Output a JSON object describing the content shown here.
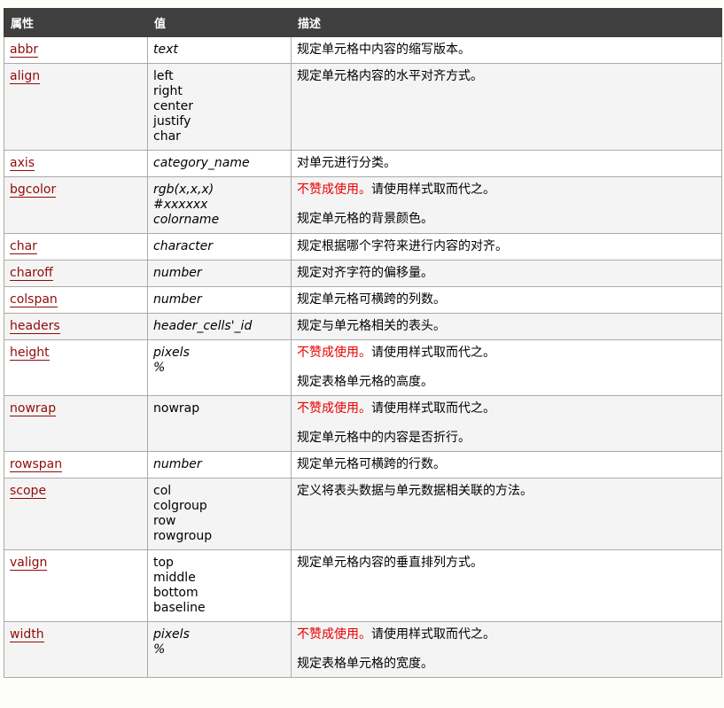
{
  "table": {
    "headers": [
      "属性",
      "值",
      "描述"
    ],
    "deprecated_label": "不赞成使用。",
    "deprecated_hint": "请使用样式取而代之。",
    "colors": {
      "header_bg": "#3f3f3f",
      "link": "#900b09",
      "deprecated": "#e80000",
      "row_alt_bg": "#f4f4f4"
    },
    "rows": [
      {
        "attribute": "abbr",
        "values": [
          {
            "text": "text",
            "italic": true
          }
        ],
        "deprecated": false,
        "description": "规定单元格中内容的缩写版本。"
      },
      {
        "attribute": "align",
        "values": [
          {
            "text": "left",
            "italic": false
          },
          {
            "text": "right",
            "italic": false
          },
          {
            "text": "center",
            "italic": false
          },
          {
            "text": "justify",
            "italic": false
          },
          {
            "text": "char",
            "italic": false
          }
        ],
        "deprecated": false,
        "description": "规定单元格内容的水平对齐方式。"
      },
      {
        "attribute": "axis",
        "values": [
          {
            "text": "category_name",
            "italic": true
          }
        ],
        "deprecated": false,
        "description": "对单元进行分类。"
      },
      {
        "attribute": "bgcolor",
        "values": [
          {
            "text": "rgb(x,x,x)",
            "italic": true
          },
          {
            "text": "#xxxxxx",
            "italic": true
          },
          {
            "text": "colorname",
            "italic": true
          }
        ],
        "deprecated": true,
        "description": "规定单元格的背景颜色。"
      },
      {
        "attribute": "char",
        "values": [
          {
            "text": "character",
            "italic": true
          }
        ],
        "deprecated": false,
        "description": "规定根据哪个字符来进行内容的对齐。"
      },
      {
        "attribute": "charoff",
        "values": [
          {
            "text": "number",
            "italic": true
          }
        ],
        "deprecated": false,
        "description": "规定对齐字符的偏移量。"
      },
      {
        "attribute": "colspan",
        "values": [
          {
            "text": "number",
            "italic": true
          }
        ],
        "deprecated": false,
        "description": "规定单元格可横跨的列数。"
      },
      {
        "attribute": "headers",
        "values": [
          {
            "text": "header_cells'_id",
            "italic": true
          }
        ],
        "deprecated": false,
        "description": "规定与单元格相关的表头。"
      },
      {
        "attribute": "height",
        "values": [
          {
            "text": "pixels",
            "italic": true
          },
          {
            "text": "%",
            "italic": true
          }
        ],
        "deprecated": true,
        "description": "规定表格单元格的高度。"
      },
      {
        "attribute": "nowrap",
        "values": [
          {
            "text": "nowrap",
            "italic": false
          }
        ],
        "deprecated": true,
        "description": "规定单元格中的内容是否折行。"
      },
      {
        "attribute": "rowspan",
        "values": [
          {
            "text": "number",
            "italic": true
          }
        ],
        "deprecated": false,
        "description": "规定单元格可横跨的行数。"
      },
      {
        "attribute": "scope",
        "values": [
          {
            "text": "col",
            "italic": false
          },
          {
            "text": "colgroup",
            "italic": false
          },
          {
            "text": "row",
            "italic": false
          },
          {
            "text": "rowgroup",
            "italic": false
          }
        ],
        "deprecated": false,
        "description": "定义将表头数据与单元数据相关联的方法。"
      },
      {
        "attribute": "valign",
        "values": [
          {
            "text": "top",
            "italic": false
          },
          {
            "text": "middle",
            "italic": false
          },
          {
            "text": "bottom",
            "italic": false
          },
          {
            "text": "baseline",
            "italic": false
          }
        ],
        "deprecated": false,
        "description": "规定单元格内容的垂直排列方式。"
      },
      {
        "attribute": "width",
        "values": [
          {
            "text": "pixels",
            "italic": true
          },
          {
            "text": "%",
            "italic": true
          }
        ],
        "deprecated": true,
        "description": "规定表格单元格的宽度。"
      }
    ]
  }
}
